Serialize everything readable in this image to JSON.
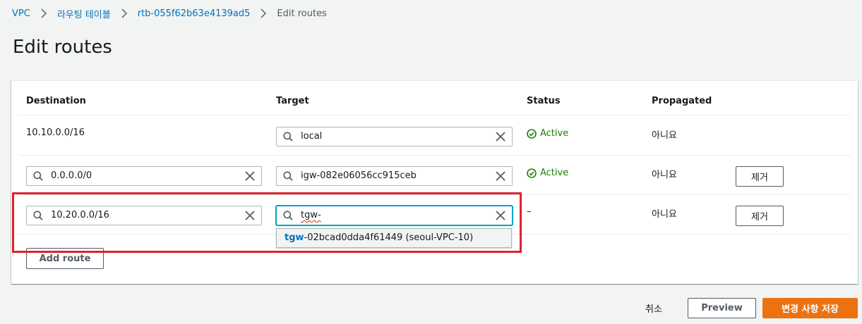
{
  "breadcrumb": {
    "items": [
      "VPC",
      "라우팅 테이블",
      "rtb-055f62b63e4139ad5",
      "Edit routes"
    ]
  },
  "page": {
    "title": "Edit routes"
  },
  "table": {
    "headers": {
      "destination": "Destination",
      "target": "Target",
      "status": "Status",
      "propagated": "Propagated"
    },
    "rows": [
      {
        "destination": "10.10.0.0/16",
        "target": "local",
        "status": "Active",
        "propagated": "아니요"
      },
      {
        "destination": "0.0.0.0/0",
        "target": "igw-082e06056cc915ceb",
        "status": "Active",
        "propagated": "아니요",
        "remove_label": "제거"
      },
      {
        "destination": "10.20.0.0/16",
        "target": "tgw-",
        "status": "–",
        "propagated": "아니요",
        "remove_label": "제거"
      }
    ],
    "suggestion": {
      "match": "tgw",
      "rest": "-02bcad0dda4f61449 (seoul-VPC-10)"
    },
    "add_route_label": "Add route"
  },
  "footer": {
    "cancel_label": "취소",
    "preview_label": "Preview",
    "save_label": "변경 사항 저장"
  },
  "colors": {
    "primary": "#ec7211",
    "link": "#0073bb",
    "success": "#1d8102",
    "highlight": "#e0222e",
    "focus": "#00a1c9"
  },
  "icons": [
    "chevron-right-icon",
    "search-icon",
    "clear-icon",
    "status-success-icon"
  ]
}
